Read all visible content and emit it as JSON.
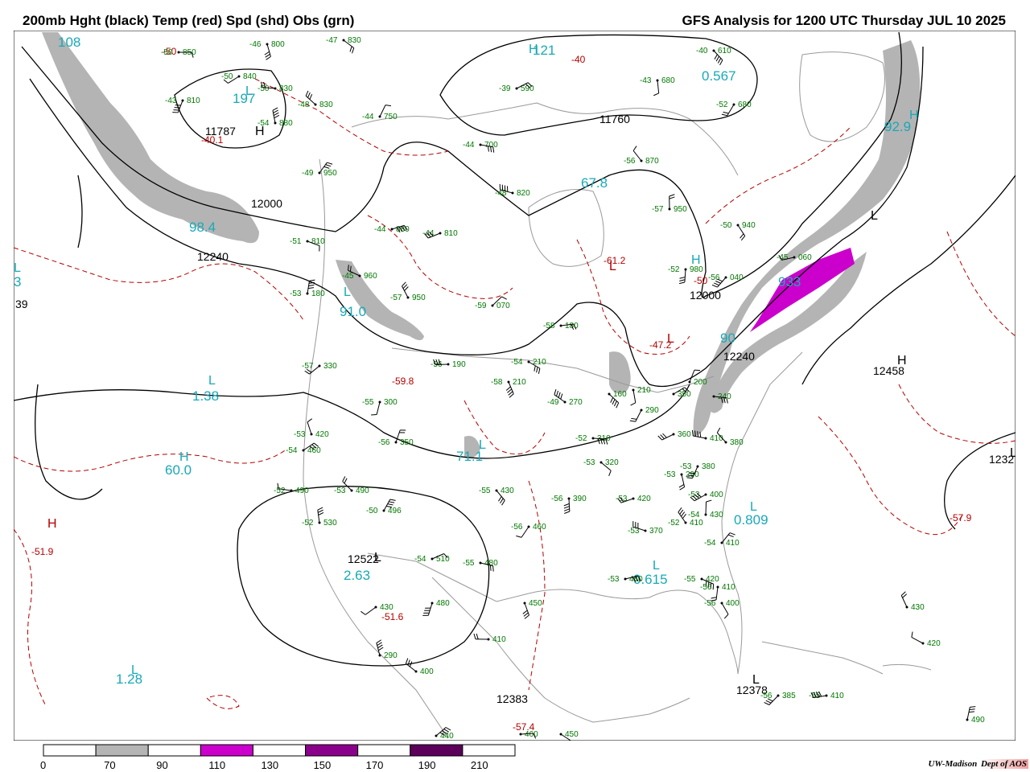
{
  "header": {
    "title_left": "200mb Hght (black) Temp (red) Spd (shd) Obs (grn)",
    "title_right": "GFS Analysis for 1200 UTC Thursday  JUL 10 2025"
  },
  "footer": {
    "credit_1": "UW-Madison",
    "credit_2": "Dept of AOS"
  },
  "legend": {
    "ticks": [
      "0",
      "70",
      "90",
      "110",
      "130",
      "150",
      "170",
      "190",
      "210"
    ],
    "colors": [
      "#ffffff",
      "#b4b4b4",
      "#ffffff",
      "#cc00cc",
      "#ffffff",
      "#8b008b",
      "#ffffff",
      "#5c005c",
      "#ffffff"
    ]
  },
  "colors": {
    "height": "#000000",
    "temp": "#b40000",
    "speed_label": "#19a9b8",
    "obs": "#007700",
    "jet": "#b4b4b4",
    "jet_max": "#cc00cc",
    "geo": "#999999"
  },
  "map": {
    "height_labels": [
      "11787",
      "11760",
      "12000",
      "12240",
      "12000",
      "12240",
      "12458",
      "12522",
      "12383",
      "12378",
      "1232",
      "39"
    ],
    "temp_labels": [
      "-50",
      "-40",
      "-40.1",
      "-61.2",
      "-47.2",
      "-50",
      "-59.8",
      "-51.9",
      "-51.6",
      "-57.4",
      "-57.9"
    ],
    "speed_labels": [
      "108",
      "121",
      "197",
      "67.8",
      "98.4",
      "91.0",
      "92.9",
      "1.38",
      "60.0",
      "2.63",
      "1.28",
      "71.1",
      "0.809",
      "0.615",
      "0.567",
      "933",
      "90",
      "3"
    ],
    "hl_markers": [
      "H",
      "L",
      "L",
      "L",
      "H",
      "L",
      "L",
      "H",
      "H",
      "L",
      "L",
      "L",
      "H",
      "L",
      "H",
      "L",
      "L",
      "L",
      "L",
      "H",
      "L"
    ],
    "obs_temps": [
      "-50",
      "-47",
      "-46",
      "-43",
      "-50",
      "-50",
      "-48",
      "-54",
      "-44",
      "-39",
      "-44",
      "-40",
      "-43",
      "-52",
      "-44",
      "-48",
      "-56",
      "-57",
      "-49",
      "-44",
      "-51",
      "-50",
      "-52",
      "-56",
      "-45",
      "-45",
      "-57",
      "-53",
      "-59",
      "-58",
      "-54",
      "-58",
      "-55",
      "-57",
      "-56",
      "-49",
      "-53",
      "-56",
      "-54",
      "-52",
      "-53",
      "-53",
      "-53",
      "-53",
      "-52",
      "-53",
      "-52",
      "-50",
      "-54",
      "-55",
      "-55",
      "-56",
      "-56",
      "-53",
      "-53",
      "-52",
      "-54",
      "-54",
      "-53",
      "-55",
      "-56",
      "-56",
      "-56",
      "-55"
    ],
    "obs_heights": [
      "850",
      "830",
      "800",
      "810",
      "840",
      "830",
      "830",
      "880",
      "750",
      "590",
      "700",
      "610",
      "680",
      "680",
      "810",
      "820",
      "870",
      "950",
      "950",
      "880",
      "810",
      "940",
      "980",
      "040",
      "060",
      "960",
      "950",
      "180",
      "070",
      "180",
      "210",
      "210",
      "300",
      "330",
      "190",
      "270",
      "420",
      "350",
      "460",
      "310",
      "320",
      "290",
      "380",
      "400",
      "490",
      "490",
      "530",
      "496",
      "510",
      "480",
      "430",
      "390",
      "460",
      "420",
      "370",
      "410",
      "430",
      "410",
      "440",
      "420",
      "400",
      "410",
      "385",
      "410",
      "420",
      "430",
      "490",
      "440",
      "460",
      "450",
      "450",
      "480",
      "430",
      "410",
      "400",
      "290",
      "200",
      "350",
      "240",
      "160",
      "210",
      "290",
      "360",
      "410",
      "380"
    ]
  }
}
